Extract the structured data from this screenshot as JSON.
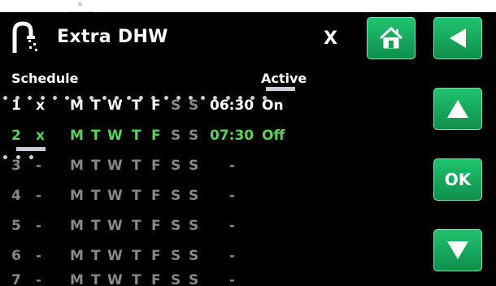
{
  "header": {
    "title": "Extra DHW",
    "close_label": "X"
  },
  "columns": {
    "schedule": "Schedule",
    "active": "Active"
  },
  "buttons": {
    "ok": "OK"
  },
  "icons": {
    "title": "tap-water-icon",
    "home": "home-icon",
    "back": "back-arrow-icon",
    "up": "up-arrow-icon",
    "down": "down-arrow-icon"
  },
  "colors": {
    "background": "#000000",
    "button": "#14a65a",
    "active_row": "#5bd25b",
    "inactive_text": "#888888"
  },
  "schedule": [
    {
      "num": "1",
      "x": "x",
      "days": [
        "M",
        "T",
        "W",
        "T",
        "F",
        "S",
        "S"
      ],
      "time": "06:30",
      "active": "On"
    },
    {
      "num": "2",
      "x": "x",
      "days": [
        "M",
        "T",
        "W",
        "T",
        "F",
        "S",
        "S"
      ],
      "time": "07:30",
      "active": "Off"
    },
    {
      "num": "3",
      "x": "-",
      "days": [
        "M",
        "T",
        "W",
        "T",
        "F",
        "S",
        "S"
      ],
      "time": "-",
      "active": ""
    },
    {
      "num": "4",
      "x": "-",
      "days": [
        "M",
        "T",
        "W",
        "T",
        "F",
        "S",
        "S"
      ],
      "time": "-",
      "active": ""
    },
    {
      "num": "5",
      "x": "-",
      "days": [
        "M",
        "T",
        "W",
        "T",
        "F",
        "S",
        "S"
      ],
      "time": "-",
      "active": ""
    },
    {
      "num": "6",
      "x": "-",
      "days": [
        "M",
        "T",
        "W",
        "T",
        "F",
        "S",
        "S"
      ],
      "time": "-",
      "active": ""
    },
    {
      "num": "7",
      "x": "-",
      "days": [
        "M",
        "T",
        "W",
        "T",
        "F",
        "S",
        "S"
      ],
      "time": "-",
      "active": ""
    }
  ]
}
